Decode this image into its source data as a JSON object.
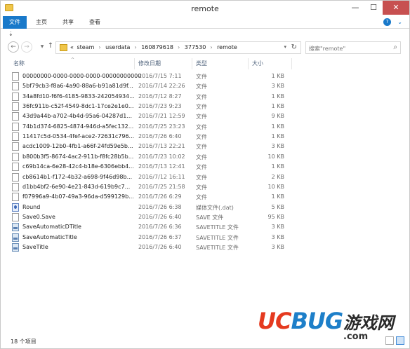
{
  "window": {
    "title": "remote"
  },
  "ribbon": {
    "tabs": [
      "文件",
      "主页",
      "共享",
      "查看"
    ]
  },
  "nav": {
    "path": [
      "«",
      "steam",
      "userdata",
      "160879618",
      "377530",
      "remote"
    ],
    "search_placeholder": "搜索\"remote\""
  },
  "columns": {
    "name": "名称",
    "date": "修改日期",
    "type": "类型",
    "size": "大小"
  },
  "files": [
    {
      "name": "00000000-0000-0000-0000-000000000000",
      "date": "2016/7/15 7:11",
      "type": "文件",
      "size": "1 KB",
      "icon": "file"
    },
    {
      "name": "5bf79cb3-f8a6-4a90-88a6-b91a81d9f...",
      "date": "2016/7/14 22:26",
      "type": "文件",
      "size": "3 KB",
      "icon": "file"
    },
    {
      "name": "34a8fd10-f6f6-4185-9833-242054934...",
      "date": "2016/7/12 8:27",
      "type": "文件",
      "size": "1 KB",
      "icon": "file"
    },
    {
      "name": "36fc911b-c52f-4549-8dc1-17ce2e1e0...",
      "date": "2016/7/23 9:23",
      "type": "文件",
      "size": "1 KB",
      "icon": "file"
    },
    {
      "name": "43d9a44b-a702-4b4d-95a6-04287d1...",
      "date": "2016/7/21 12:59",
      "type": "文件",
      "size": "9 KB",
      "icon": "file"
    },
    {
      "name": "74b1d374-6825-4874-946d-a5fec132...",
      "date": "2016/7/25 23:23",
      "type": "文件",
      "size": "1 KB",
      "icon": "file"
    },
    {
      "name": "11417c5d-0534-4fef-ace2-72631c796...",
      "date": "2016/7/26 6:40",
      "type": "文件",
      "size": "1 KB",
      "icon": "file"
    },
    {
      "name": "acdc1009-12b0-4fb1-a66f-24fd59e5b...",
      "date": "2016/7/13 22:21",
      "type": "文件",
      "size": "3 KB",
      "icon": "file"
    },
    {
      "name": "b800b3f5-8674-4ac2-911b-f8fc28b5b...",
      "date": "2016/7/23 10:02",
      "type": "文件",
      "size": "10 KB",
      "icon": "file"
    },
    {
      "name": "c69b14ca-6e28-42c4-b18e-6306ebb4...",
      "date": "2016/7/13 12:41",
      "type": "文件",
      "size": "1 KB",
      "icon": "file"
    },
    {
      "name": "cb8614b1-f172-4b32-a698-9f46d98b...",
      "date": "2016/7/12 16:11",
      "type": "文件",
      "size": "2 KB",
      "icon": "file"
    },
    {
      "name": "d1bb4bf2-6e90-4e21-843d-619b9c7...",
      "date": "2016/7/25 21:58",
      "type": "文件",
      "size": "10 KB",
      "icon": "file"
    },
    {
      "name": "f07996a9-4b07-49a3-96da-d599129b...",
      "date": "2016/7/26 6:29",
      "type": "文件",
      "size": "1 KB",
      "icon": "file"
    },
    {
      "name": "Round",
      "date": "2016/7/26 6:38",
      "type": "媒体文件(.dat)",
      "size": "5 KB",
      "icon": "media"
    },
    {
      "name": "Save0.Save",
      "date": "2016/7/26 6:40",
      "type": "SAVE 文件",
      "size": "95 KB",
      "icon": "file"
    },
    {
      "name": "SaveAutomaticDTitle",
      "date": "2016/7/26 6:36",
      "type": "SAVETITLE 文件",
      "size": "3 KB",
      "icon": "save"
    },
    {
      "name": "SaveAutomaticTitle",
      "date": "2016/7/26 6:37",
      "type": "SAVETITLE 文件",
      "size": "3 KB",
      "icon": "save"
    },
    {
      "name": "SaveTitle",
      "date": "2016/7/26 6:40",
      "type": "SAVETITLE 文件",
      "size": "3 KB",
      "icon": "save"
    }
  ],
  "status": {
    "count": "18 个项目"
  },
  "watermark": {
    "brand_a": "UC",
    "brand_b": "BUG",
    "cn": "游戏网",
    "com": ".com"
  }
}
